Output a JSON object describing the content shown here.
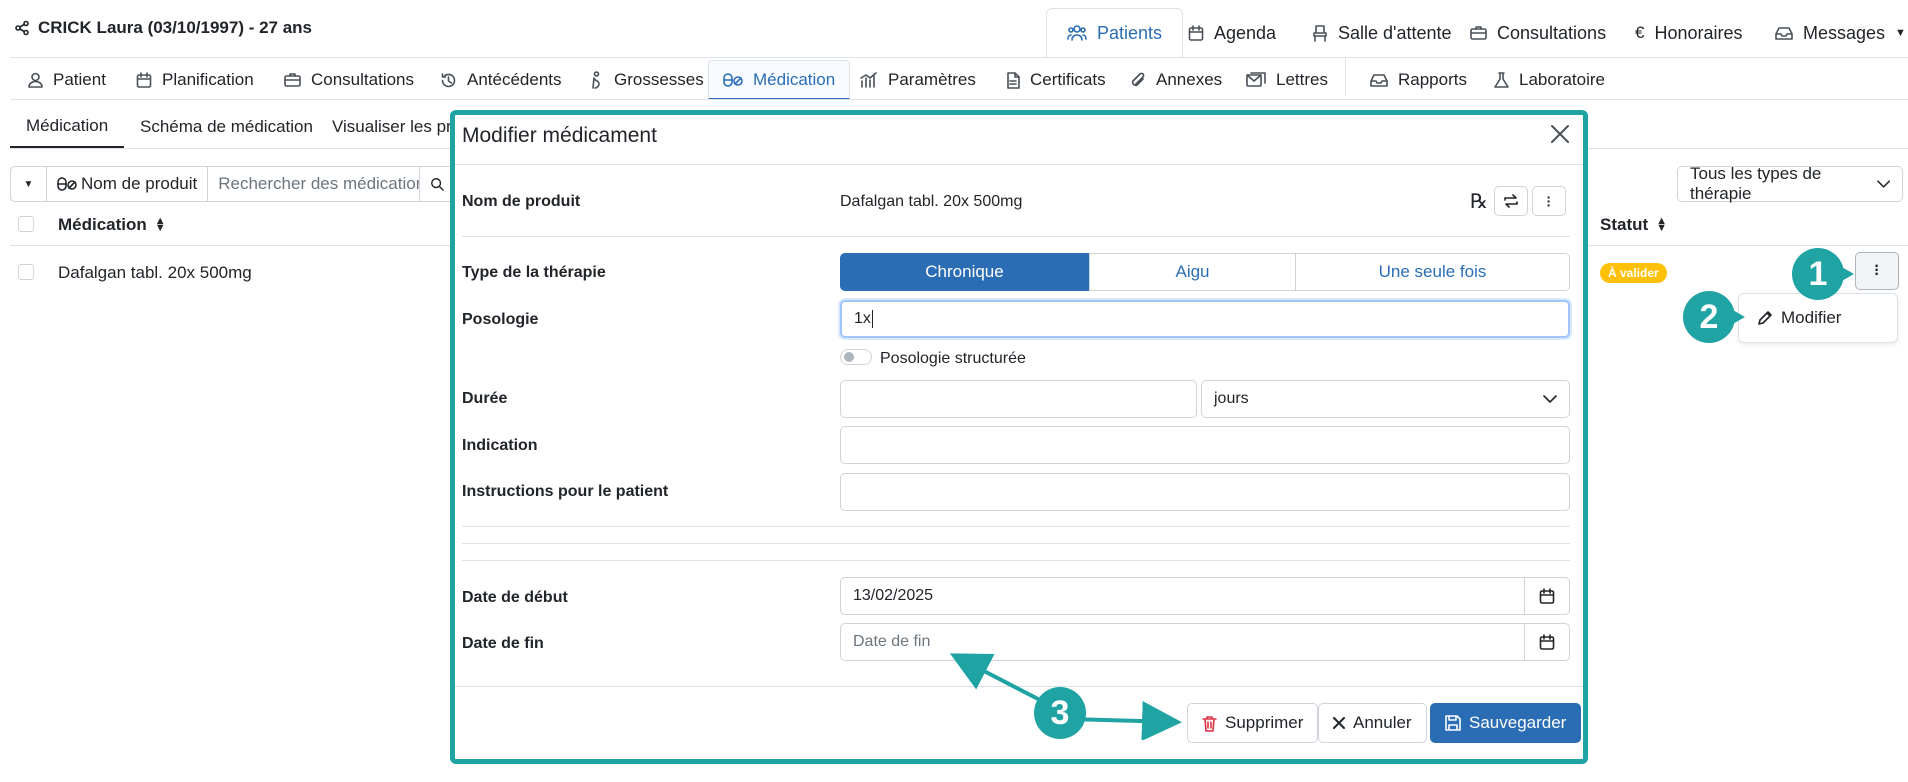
{
  "header": {
    "patient": "CRICK Laura (03/10/1997) - 27 ans",
    "tabs": [
      {
        "label": "Patients",
        "icon": "users-icon"
      },
      {
        "label": "Agenda",
        "icon": "calendar-icon"
      },
      {
        "label": "Salle d'attente",
        "icon": "chair-icon"
      },
      {
        "label": "Consultations",
        "icon": "briefcase-icon"
      },
      {
        "label": "Honoraires",
        "icon": "euro-icon"
      },
      {
        "label": "Messages",
        "icon": "inbox-icon"
      }
    ]
  },
  "nav": {
    "items": [
      {
        "label": "Patient"
      },
      {
        "label": "Planification"
      },
      {
        "label": "Consultations"
      },
      {
        "label": "Antécédents"
      },
      {
        "label": "Grossesses"
      },
      {
        "label": "Médication"
      },
      {
        "label": "Paramètres"
      },
      {
        "label": "Certificats"
      },
      {
        "label": "Annexes"
      },
      {
        "label": "Lettres"
      },
      {
        "label": "Rapports"
      },
      {
        "label": "Laboratoire"
      }
    ]
  },
  "subtabs": [
    "Médication",
    "Schéma de médication",
    "Visualiser les pre"
  ],
  "toolbar": {
    "product_label": "Nom de produit",
    "search_placeholder": "Rechercher des médicatior",
    "therapy_filter": "Tous les types de thérapie"
  },
  "table": {
    "col_medication": "Médication",
    "col_status": "Statut",
    "rows": [
      {
        "name": "Dafalgan tabl. 20x 500mg",
        "status": "À valider"
      }
    ]
  },
  "context_menu": {
    "modify": "Modifier"
  },
  "callouts": [
    "1",
    "2",
    "3"
  ],
  "modal": {
    "title": "Modifier médicament",
    "product_label": "Nom de produit",
    "product_value": "Dafalgan tabl. 20x 500mg",
    "rx_symbol": "℞",
    "therapy_label": "Type de la thérapie",
    "therapy_options": [
      "Chronique",
      "Aigu",
      "Une seule fois"
    ],
    "therapy_selected": "Chronique",
    "posology_label": "Posologie",
    "posology_value": "1x",
    "structured_label": "Posologie structurée",
    "duration_label": "Durée",
    "duration_unit": "jours",
    "indication_label": "Indication",
    "instructions_label": "Instructions pour le patient",
    "start_label": "Date de début",
    "start_value": "13/02/2025",
    "end_label": "Date de fin",
    "end_placeholder": "Date de fin",
    "delete_label": "Supprimer",
    "cancel_label": "Annuler",
    "save_label": "Sauvegarder"
  },
  "colors": {
    "accent": "#2a6db5",
    "callout": "#1fa3a3",
    "badge": "#ffc107",
    "danger": "#dc3545"
  }
}
